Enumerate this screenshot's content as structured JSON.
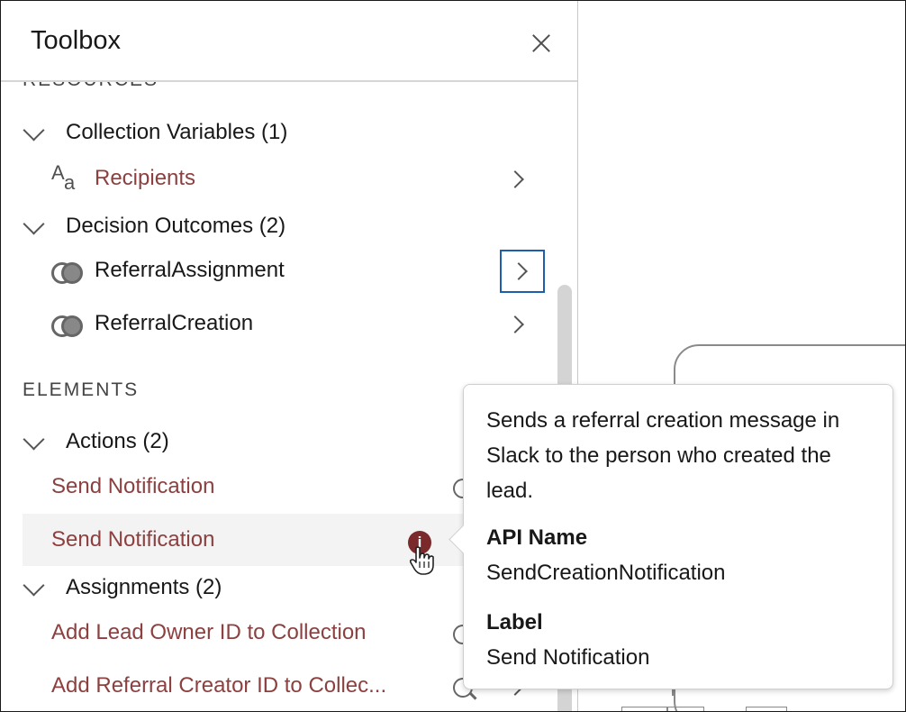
{
  "panel": {
    "title": "Toolbox",
    "close_icon": "close-icon"
  },
  "resources": {
    "heading": "RESOURCES",
    "collection_variables": {
      "label": "Collection Variables (1)",
      "items": [
        {
          "label": "Recipients",
          "icon": "text-variable-icon"
        }
      ]
    },
    "decision_outcomes": {
      "label": "Decision Outcomes (2)",
      "items": [
        {
          "label": "ReferralAssignment",
          "icon": "outcome-icon"
        },
        {
          "label": "ReferralCreation",
          "icon": "outcome-icon"
        }
      ]
    }
  },
  "elements": {
    "heading": "ELEMENTS",
    "actions": {
      "label": "Actions (2)",
      "items": [
        {
          "label": "Send Notification"
        },
        {
          "label": "Send Notification"
        }
      ]
    },
    "assignments": {
      "label": "Assignments (2)",
      "items": [
        {
          "label": "Add Lead Owner ID to Collection"
        },
        {
          "label": "Add Referral Creator ID to Collec..."
        }
      ]
    }
  },
  "tooltip": {
    "description": "Sends a referral creation message in Slack to the person who created the lead.",
    "api_name_label": "API Name",
    "api_name_value": "SendCreationNotification",
    "label_label": "Label",
    "label_value": "Send Notification"
  },
  "colors": {
    "link": "#8c4040",
    "focus": "#1b5fad",
    "info_badge": "#7a2a2a"
  }
}
